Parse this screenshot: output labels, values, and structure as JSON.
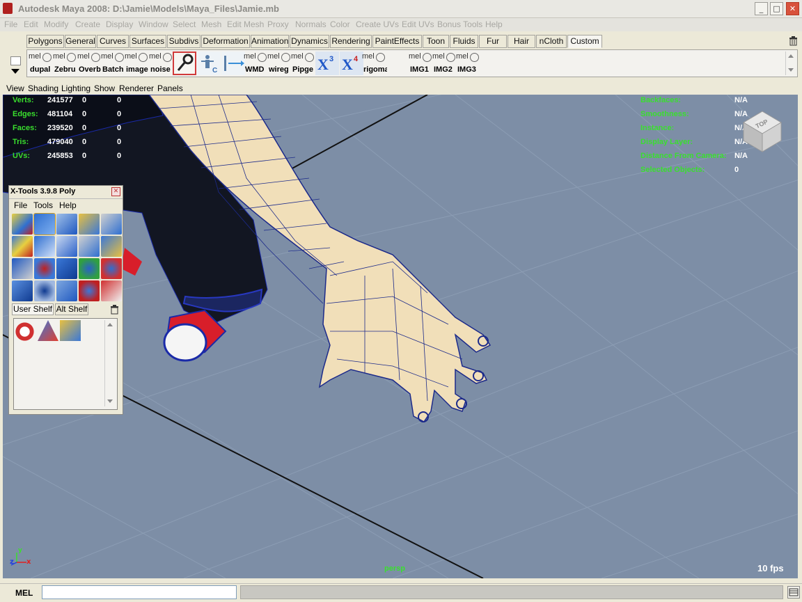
{
  "window": {
    "title": "Autodesk Maya 2008: D:\\Jamie\\Models\\Maya_Files\\Jamie.mb",
    "minimize": "_",
    "maximize": "□",
    "close": "✕"
  },
  "menubar": [
    "File",
    "Edit",
    "Modify",
    "Create",
    "Display",
    "Window",
    "Select",
    "Mesh",
    "Edit Mesh",
    "Proxy",
    "Normals",
    "Color",
    "Create UVs",
    "Edit UVs",
    "Bonus Tools",
    "Help"
  ],
  "shelf_tabs": [
    "Polygons",
    "General",
    "Curves",
    "Surfaces",
    "Subdivs",
    "Deformation",
    "Animation",
    "Dynamics",
    "Rendering",
    "PaintEffects",
    "Toon",
    "Fluids",
    "Fur",
    "Hair",
    "nCloth",
    "Custom"
  ],
  "shelf_active_tab": "Custom",
  "shelf_buttons": [
    {
      "tag": "mel",
      "label": "dupal"
    },
    {
      "tag": "mel",
      "label": "Zebru"
    },
    {
      "tag": "mel",
      "label": "Overb"
    },
    {
      "tag": "mel",
      "label": "Batch"
    },
    {
      "tag": "mel",
      "label": "image"
    },
    {
      "tag": "mel",
      "label": "noise"
    },
    {
      "tag": "",
      "label": ""
    },
    {
      "tag": "",
      "label": ""
    },
    {
      "tag": "",
      "label": ""
    },
    {
      "tag": "mel",
      "label": "WMD"
    },
    {
      "tag": "mel",
      "label": "wireg"
    },
    {
      "tag": "mel",
      "label": "Pipge"
    },
    {
      "tag": "X3",
      "label": ""
    },
    {
      "tag": "X4",
      "label": ""
    },
    {
      "tag": "mel",
      "label": "rigoma"
    },
    {
      "tag": "mel",
      "label": "IMG1"
    },
    {
      "tag": "mel",
      "label": "IMG2"
    },
    {
      "tag": "mel",
      "label": "IMG3"
    }
  ],
  "panel_menu": [
    "View",
    "Shading",
    "Lighting",
    "Show",
    "Renderer",
    "Panels"
  ],
  "poly_stats": [
    {
      "label": "Verts:",
      "a": "241577",
      "b": "0",
      "c": "0"
    },
    {
      "label": "Edges:",
      "a": "481104",
      "b": "0",
      "c": "0"
    },
    {
      "label": "Faces:",
      "a": "239520",
      "b": "0",
      "c": "0"
    },
    {
      "label": "Tris:",
      "a": "479040",
      "b": "0",
      "c": "0"
    },
    {
      "label": "UVs:",
      "a": "245853",
      "b": "0",
      "c": "0"
    }
  ],
  "hud_right": [
    {
      "label": "Backfaces:",
      "value": "N/A"
    },
    {
      "label": "Smoothness:",
      "value": "N/A"
    },
    {
      "label": "Instance:",
      "value": "N/A"
    },
    {
      "label": "Display Layer:",
      "value": "N/A"
    },
    {
      "label": "Distance From Camera:",
      "value": "N/A"
    },
    {
      "label": "Selected Objects:",
      "value": "0"
    }
  ],
  "view_cube": "TOP",
  "camera_name": "persp",
  "fps": "10 fps",
  "axis": {
    "y": "y",
    "z": "z",
    "x": "x"
  },
  "xtools": {
    "title": "X-Tools 3.9.8 Poly",
    "menu": [
      "File",
      "Tools",
      "Help"
    ],
    "tabs": [
      "User Shelf",
      "Alt Shelf"
    ]
  },
  "status": {
    "mel_label": "MEL",
    "mel_input": ""
  },
  "colors": {
    "viewport_bg": "#7d8ea6",
    "grid_line": "#8c9db4",
    "skin": "#f1dfb9",
    "wire": "#1c2a8a",
    "hud_green": "#3adf2e"
  }
}
